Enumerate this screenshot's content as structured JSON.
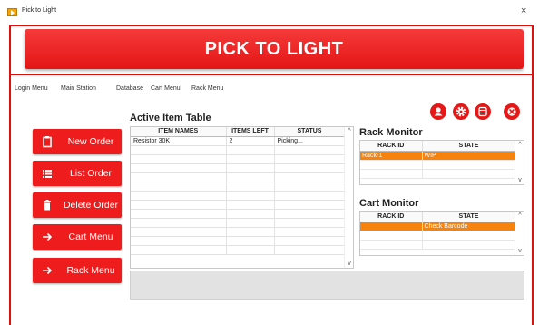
{
  "window": {
    "title": "Pick to Light",
    "close_glyph": "×"
  },
  "banner": {
    "title": "PICK TO LIGHT",
    "color": "#e41515"
  },
  "menu": [
    "Login Menu",
    "Main Station",
    "Database",
    "Cart Menu",
    "Rack Menu"
  ],
  "icon_buttons": [
    {
      "name": "user-icon"
    },
    {
      "name": "gear-icon"
    },
    {
      "name": "database-icon"
    },
    {
      "name": "close-circle-icon"
    }
  ],
  "side_buttons": [
    {
      "label": "New Order",
      "icon": "clipboard-icon"
    },
    {
      "label": "List Order",
      "icon": "list-icon"
    },
    {
      "label": "Delete Order",
      "icon": "trash-icon"
    },
    {
      "label": "Cart Menu",
      "icon": "arrow-right-icon"
    },
    {
      "label": "Rack Menu",
      "icon": "arrow-right-icon"
    }
  ],
  "active_table": {
    "title": "Active Item Table",
    "columns": [
      "ITEM NAMES",
      "ITEMS LEFT",
      "STATUS"
    ],
    "rows": [
      [
        "Resistor 30K",
        "2",
        "Picking..."
      ],
      [
        "",
        "",
        ""
      ],
      [
        "",
        "",
        ""
      ],
      [
        "",
        "",
        ""
      ],
      [
        "",
        "",
        ""
      ],
      [
        "",
        "",
        ""
      ],
      [
        "",
        "",
        ""
      ],
      [
        "",
        "",
        ""
      ],
      [
        "",
        "",
        ""
      ],
      [
        "",
        "",
        ""
      ],
      [
        "",
        "",
        ""
      ],
      [
        "",
        "",
        ""
      ],
      [
        "",
        "",
        ""
      ]
    ]
  },
  "rack_monitor": {
    "title": "Rack Monitor",
    "columns": [
      "RACK ID",
      "STATE"
    ],
    "rows": [
      [
        "Rack-1",
        "WIP"
      ],
      [
        "",
        ""
      ],
      [
        "",
        ""
      ]
    ],
    "highlight_color": "#f7830f"
  },
  "cart_monitor": {
    "title": "Cart Monitor",
    "columns": [
      "RACK ID",
      "STATE"
    ],
    "rows": [
      [
        "",
        "Check Barcode"
      ],
      [
        "",
        ""
      ],
      [
        "",
        ""
      ]
    ],
    "highlight_color": "#f7830f"
  },
  "scroll_glyphs": {
    "up": "^",
    "down": "v"
  }
}
